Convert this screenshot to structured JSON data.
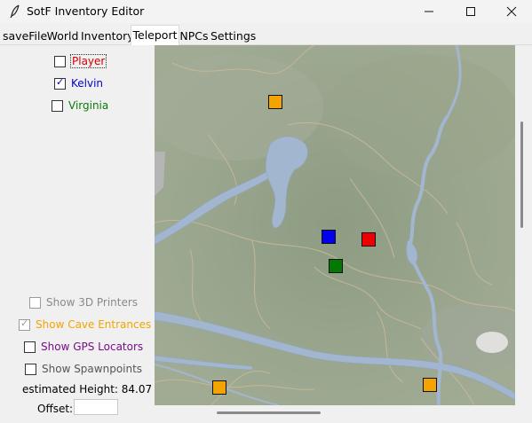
{
  "window": {
    "title": "SotF Inventory Editor",
    "controls": {
      "minimize": "—",
      "maximize": "☐",
      "close": "✕"
    }
  },
  "tabs": [
    {
      "label": "saveFile",
      "active": false
    },
    {
      "label": "World",
      "active": false
    },
    {
      "label": "Inventory",
      "active": false
    },
    {
      "label": "Teleport",
      "active": true
    },
    {
      "label": "NPCs",
      "active": false
    },
    {
      "label": "Settings",
      "active": false
    }
  ],
  "characters": [
    {
      "label": "Player",
      "checked": false,
      "color": "#d40000"
    },
    {
      "label": "Kelvin",
      "checked": true,
      "color": "#0000d0"
    },
    {
      "label": "Virginia",
      "checked": false,
      "color": "#0a7a0a"
    }
  ],
  "options": [
    {
      "label": "Show 3D Printers",
      "checked": false,
      "enabled": false,
      "color": "#8a8a8a"
    },
    {
      "label": "Show Cave Entrances",
      "checked": true,
      "enabled": false,
      "color": "#f4a400"
    },
    {
      "label": "Show GPS Locators",
      "checked": false,
      "enabled": true,
      "color": "#7a0d8a"
    },
    {
      "label": "Show Spawnpoints",
      "checked": false,
      "enabled": true,
      "color": "#555555"
    }
  ],
  "height": {
    "label": "estimated Height: 84.07"
  },
  "offset": {
    "label": "Offset:",
    "value": ""
  },
  "markers": [
    {
      "name": "cave-entrance-marker",
      "color": "#f4a400"
    },
    {
      "name": "cave-entrance-marker",
      "color": "#f4a400"
    },
    {
      "name": "cave-entrance-marker",
      "color": "#f4a400"
    },
    {
      "name": "kelvin-marker",
      "color": "#0000ee"
    },
    {
      "name": "player-marker",
      "color": "#ee0000"
    },
    {
      "name": "virginia-marker",
      "color": "#007a00"
    }
  ]
}
